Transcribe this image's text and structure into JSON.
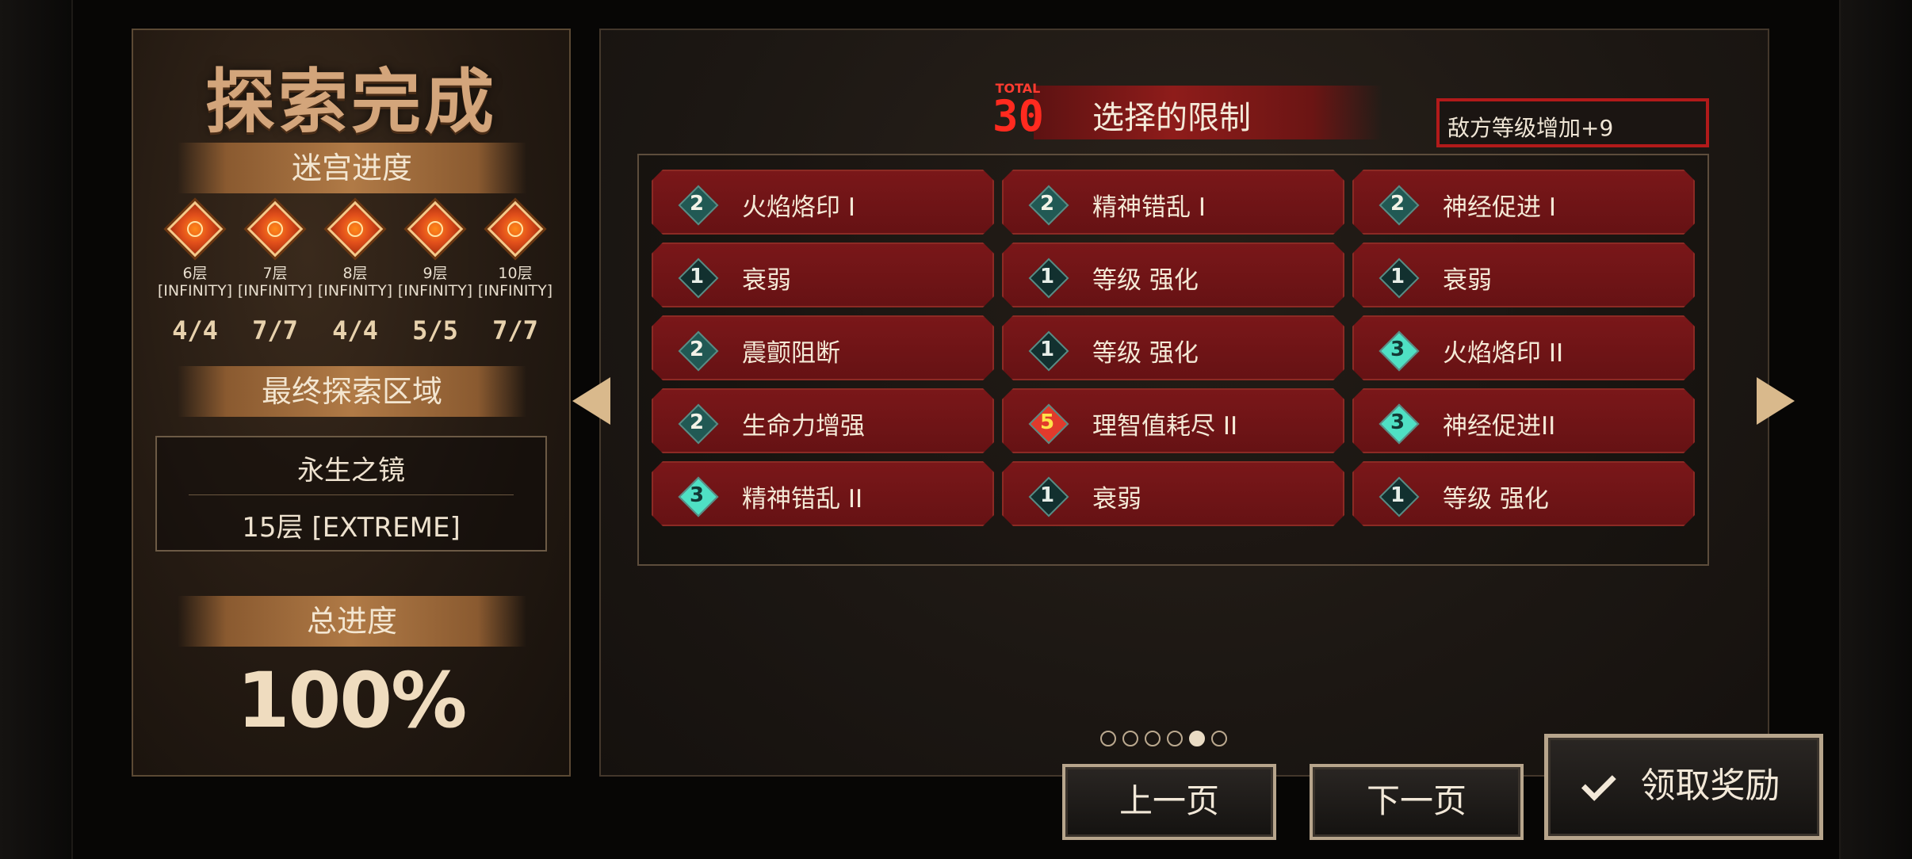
{
  "left_panel": {
    "title": "探索完成",
    "maze_progress_label": "迷宫进度",
    "floors": [
      {
        "name": "6层",
        "difficulty": "[INFINITY]",
        "count": "4/4"
      },
      {
        "name": "7层",
        "difficulty": "[INFINITY]",
        "count": "7/7"
      },
      {
        "name": "8层",
        "difficulty": "[INFINITY]",
        "count": "4/4"
      },
      {
        "name": "9层",
        "difficulty": "[INFINITY]",
        "count": "5/5"
      },
      {
        "name": "10层",
        "difficulty": "[INFINITY]",
        "count": "7/7"
      }
    ],
    "final_area_label": "最终探索区域",
    "final_area_name": "永生之镜",
    "final_area_floor": "15层 [EXTREME]",
    "total_progress_label": "总进度",
    "total_progress_value": "100%"
  },
  "restrictions": {
    "total_label": "TOTAL",
    "total_value": "30",
    "title": "选择的限制",
    "summary": "敌方等级增加+9",
    "items": [
      {
        "level": "2",
        "label": "火焰烙印 I"
      },
      {
        "level": "2",
        "label": "精神错乱 I"
      },
      {
        "level": "2",
        "label": "神经促进 I"
      },
      {
        "level": "1",
        "label": "衰弱"
      },
      {
        "level": "1",
        "label": "等级 强化"
      },
      {
        "level": "1",
        "label": "衰弱"
      },
      {
        "level": "2",
        "label": "震颤阻断"
      },
      {
        "level": "1",
        "label": "等级 强化"
      },
      {
        "level": "3",
        "label": "火焰烙印 II"
      },
      {
        "level": "2",
        "label": "生命力增强"
      },
      {
        "level": "5",
        "label": "理智值耗尽 II"
      },
      {
        "level": "3",
        "label": "神经促进II"
      },
      {
        "level": "3",
        "label": "精神错乱 II"
      },
      {
        "level": "1",
        "label": "衰弱"
      },
      {
        "level": "1",
        "label": "等级 强化"
      }
    ]
  },
  "pagination": {
    "total_pages": 6,
    "current_page": 5
  },
  "buttons": {
    "prev": "上一页",
    "next": "下一页",
    "claim": "领取奖励"
  },
  "icons": {
    "floor_gem": "floor-gem-icon",
    "prev_arrow": "arrow-left-icon",
    "next_arrow": "arrow-right-icon",
    "claim": "checkmark-icon"
  },
  "colors": {
    "restriction_cell": "#6f1517",
    "summary_border": "#b21a1a",
    "total_red": "#ff2a1f",
    "title_gold": "#d3a57b"
  }
}
